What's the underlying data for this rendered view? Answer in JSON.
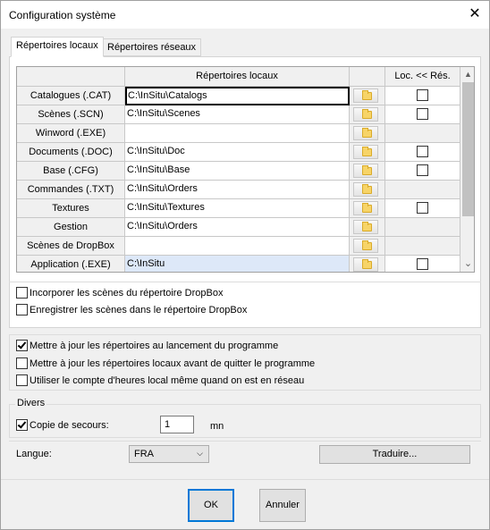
{
  "window": {
    "title": "Configuration système",
    "close_label": "✕"
  },
  "tabs": [
    {
      "label": "Répertoires locaux",
      "active": true
    },
    {
      "label": "Répertoires réseaux",
      "active": false
    }
  ],
  "grid": {
    "columns": {
      "row_header": "",
      "path": "Répertoires locaux",
      "browse": "",
      "loc_res": "Loc. << Rés."
    },
    "rows": [
      {
        "label": "Catalogues (.CAT)",
        "path": "C:\\InSitu\\Catalogs",
        "has_checkbox": true,
        "checked": false
      },
      {
        "label": "Scènes (.SCN)",
        "path": "C:\\InSitu\\Scenes",
        "has_checkbox": true,
        "checked": false
      },
      {
        "label": "Winword (.EXE)",
        "path": "",
        "has_checkbox": false,
        "checked": false
      },
      {
        "label": "Documents (.DOC)",
        "path": "C:\\InSitu\\Doc",
        "has_checkbox": true,
        "checked": false
      },
      {
        "label": "Base (.CFG)",
        "path": "C:\\InSitu\\Base",
        "has_checkbox": true,
        "checked": false
      },
      {
        "label": "Commandes (.TXT)",
        "path": "C:\\InSitu\\Orders",
        "has_checkbox": false,
        "checked": false
      },
      {
        "label": "Textures",
        "path": "C:\\InSitu\\Textures",
        "has_checkbox": true,
        "checked": false
      },
      {
        "label": "Gestion",
        "path": "C:\\InSitu\\Orders",
        "has_checkbox": false,
        "checked": false
      },
      {
        "label": "Scènes de DropBox",
        "path": "",
        "has_checkbox": false,
        "checked": false
      },
      {
        "label": "Application (.EXE)",
        "path": "C:\\InSitu",
        "has_checkbox": true,
        "checked": false
      }
    ],
    "scroll_up": "▲",
    "scroll_down": "⌄"
  },
  "dropbox_options": {
    "incorporate": {
      "label": "Incorporer les scènes du répertoire DropBox",
      "checked": false
    },
    "save": {
      "label": "Enregistrer les scènes dans le répertoire DropBox",
      "checked": false
    }
  },
  "update_options": {
    "on_start": {
      "label": "Mettre à jour les répertoires au lancement du programme",
      "checked": true
    },
    "before_quit": {
      "label": "Mettre à jour les répertoires locaux avant de quitter le programme",
      "checked": false
    },
    "local_hours": {
      "label": "Utiliser le compte d'heures local même quand on est en réseau",
      "checked": false
    }
  },
  "divers": {
    "legend": "Divers",
    "backup": {
      "label": "Copie de secours:",
      "checked": true,
      "value": "1",
      "unit": "mn"
    }
  },
  "language": {
    "label": "Langue:",
    "selected": "FRA",
    "arrow": "⌵",
    "translate_button": "Traduire..."
  },
  "footer": {
    "ok": "OK",
    "cancel": "Annuler"
  }
}
